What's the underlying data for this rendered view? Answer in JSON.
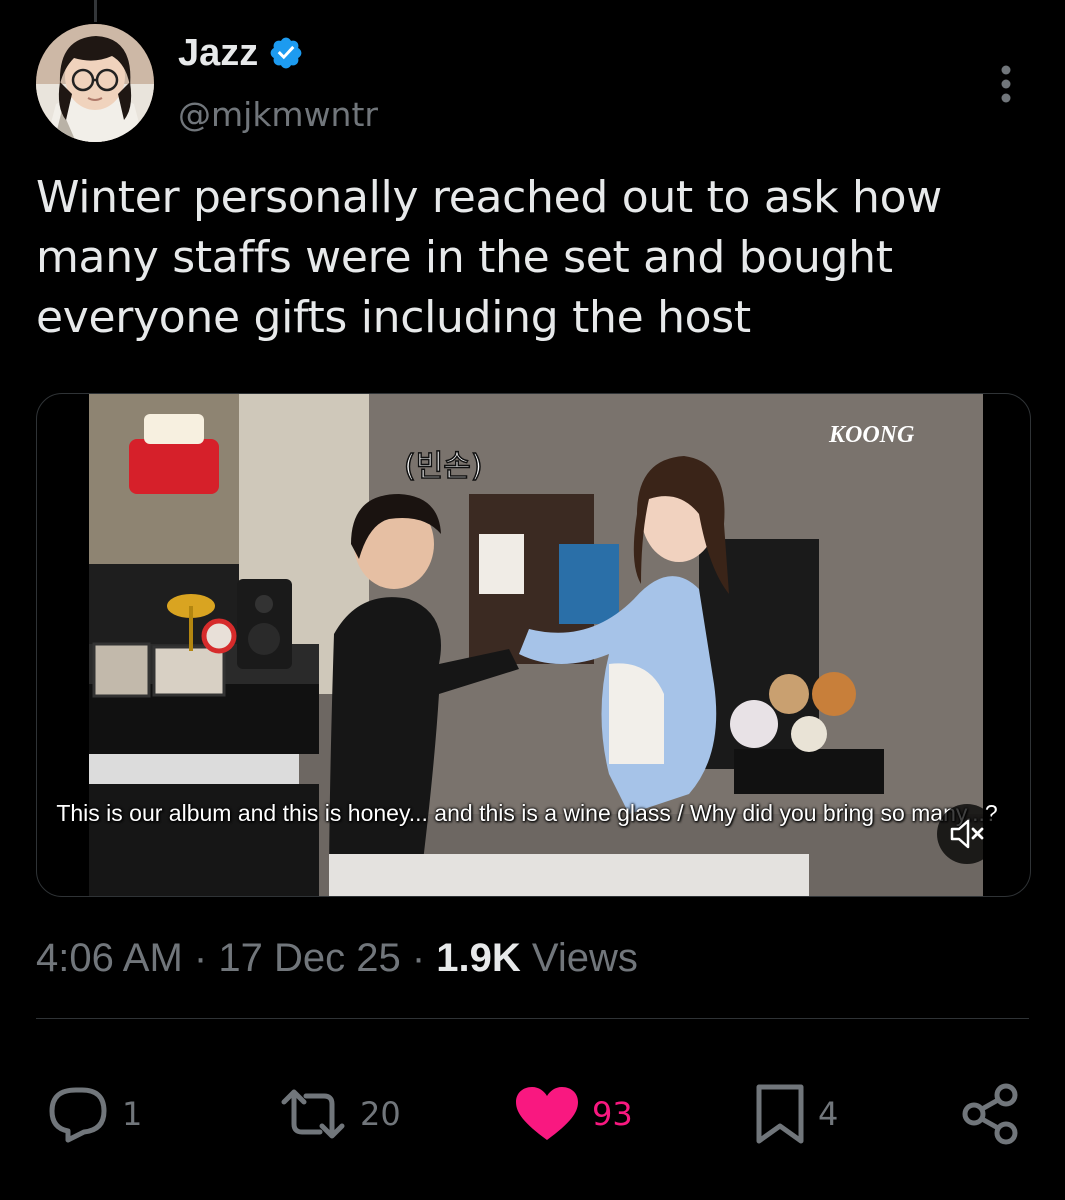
{
  "author": {
    "display_name": "Jazz",
    "handle": "@mjkmwntr",
    "verified": true
  },
  "tweet": {
    "text": "Winter personally reached out to ask how many staffs were in the set and bought everyone gifts including the host"
  },
  "media": {
    "video_overlay_title": "(빈손)",
    "show_logo_text": "KOONG",
    "caption": "This is our album and this is honey... and this is a wine glass / Why did you bring so many...?"
  },
  "meta": {
    "time": "4:06 AM",
    "separator": "·",
    "date": "17 Dec 25",
    "views_count": "1.9K",
    "views_label": "Views"
  },
  "actions": {
    "reply_count": "1",
    "repost_count": "20",
    "like_count": "93",
    "bookmark_count": "4"
  },
  "icons": {
    "verified": "verified-badge-icon",
    "more": "more-dots-icon",
    "mute": "muted-speaker-icon",
    "reply": "reply-bubble-icon",
    "repost": "repost-icon",
    "like": "heart-icon",
    "bookmark": "bookmark-icon",
    "share": "share-icon"
  },
  "colors": {
    "background": "#000000",
    "text_primary": "#e7e9ea",
    "text_secondary": "#71767b",
    "verified": "#1d9bf0",
    "like": "#f91880",
    "divider": "#2f3336"
  }
}
